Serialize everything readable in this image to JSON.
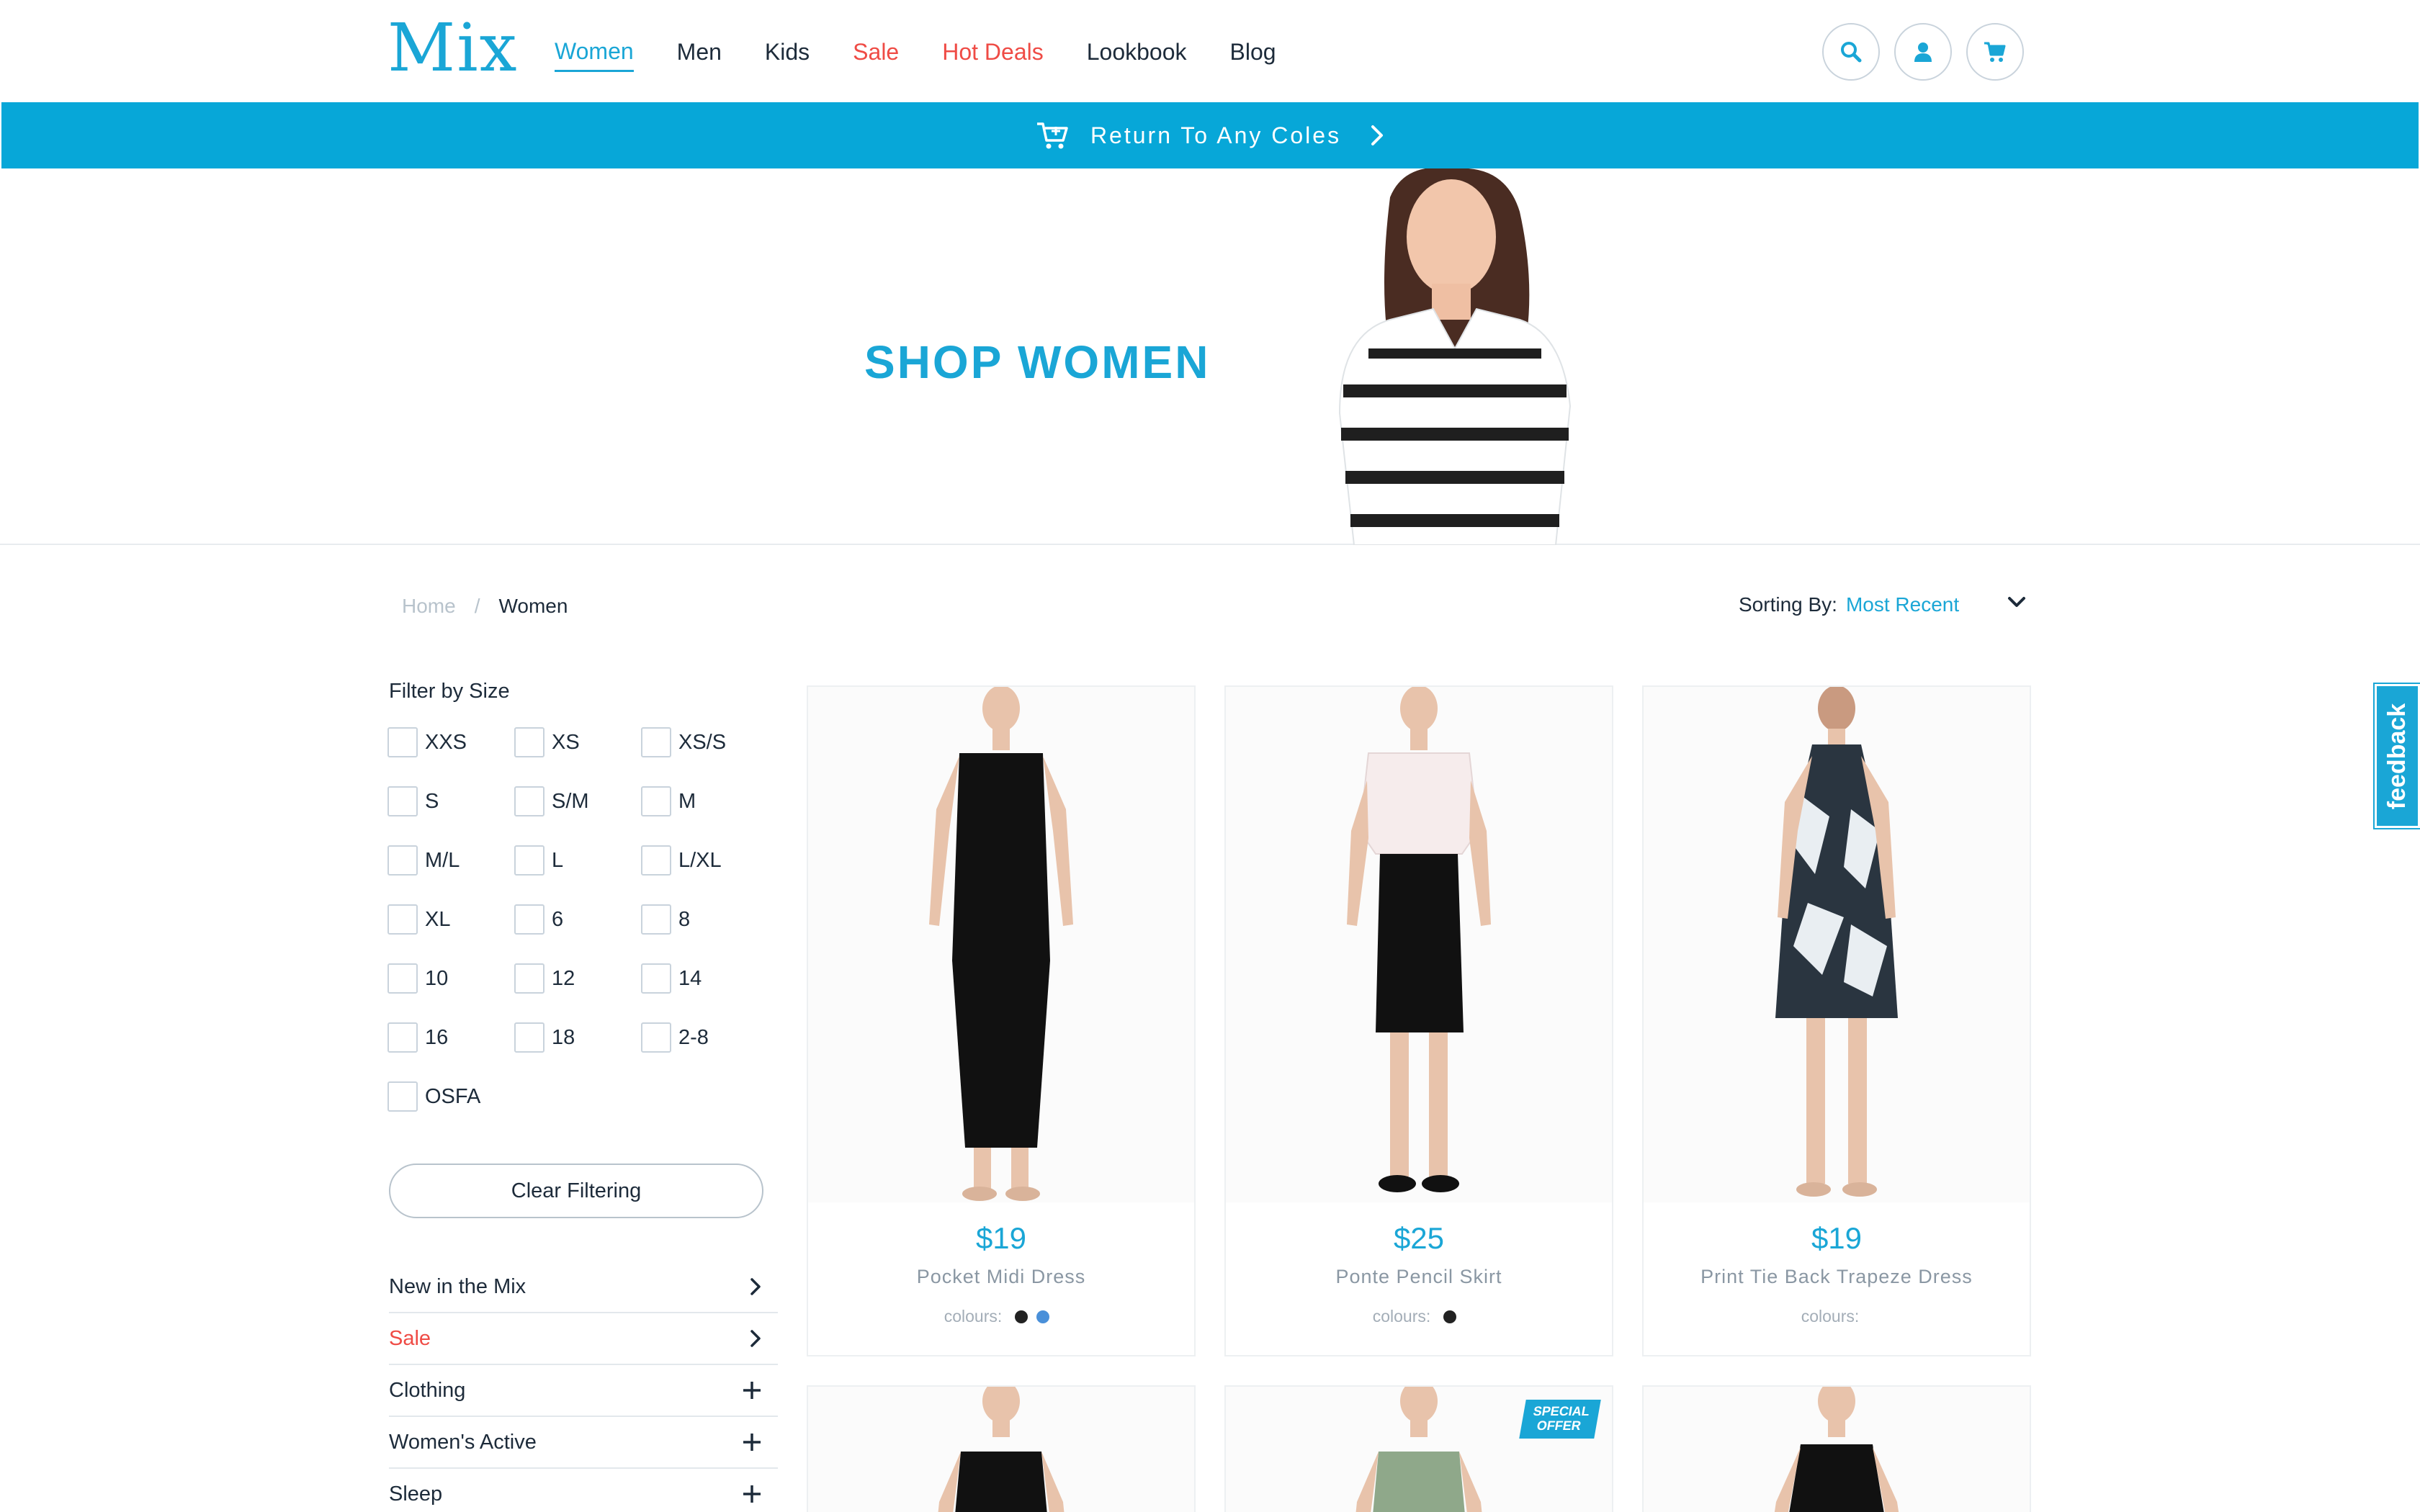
{
  "header": {
    "logo": "Mix",
    "nav": [
      "Women",
      "Men",
      "Kids",
      "Sale",
      "Hot Deals",
      "Lookbook",
      "Blog"
    ],
    "icons": [
      "search-icon",
      "user-icon",
      "cart-icon"
    ]
  },
  "promo": {
    "text": "Return To Any Coles",
    "icon": "cart-icon"
  },
  "hero": {
    "title": "SHOP WOMEN"
  },
  "breadcrumb": {
    "home": "Home",
    "separator": "/",
    "current": "Women"
  },
  "sorting": {
    "label": "Sorting By:",
    "value": "Most Recent"
  },
  "filter": {
    "title": "Filter by Size",
    "sizes": [
      "XXS",
      "XS",
      "XS/S",
      "S",
      "S/M",
      "M",
      "M/L",
      "L",
      "L/XL",
      "XL",
      "6",
      "8",
      "10",
      "12",
      "14",
      "16",
      "18",
      "2-8",
      "OSFA"
    ],
    "clear_label": "Clear Filtering"
  },
  "categories": [
    {
      "label": "New in the Mix",
      "action": "chevron-right-icon"
    },
    {
      "label": "Sale",
      "action": "chevron-right-icon"
    },
    {
      "label": "Clothing",
      "action": "plus-icon"
    },
    {
      "label": "Women's Active",
      "action": "plus-icon"
    },
    {
      "label": "Sleep",
      "action": "plus-icon"
    }
  ],
  "products": [
    {
      "price": "$19",
      "name": "Pocket Midi Dress",
      "colours_label": "colours:",
      "swatches": [
        "#222222",
        "#4a90d9"
      ]
    },
    {
      "price": "$25",
      "name": "Ponte Pencil Skirt",
      "colours_label": "colours:",
      "swatches": [
        "#222222"
      ]
    },
    {
      "price": "$19",
      "name": "Print Tie Back Trapeze Dress",
      "colours_label": "colours:",
      "swatches": []
    }
  ],
  "second_row": {
    "badge": "SPECIAL OFFER"
  },
  "feedback": {
    "label": "feedback"
  },
  "colors": {
    "accent": "#1aa6d6",
    "sale_red": "#ef4b45",
    "text": "#1d2b3a"
  }
}
